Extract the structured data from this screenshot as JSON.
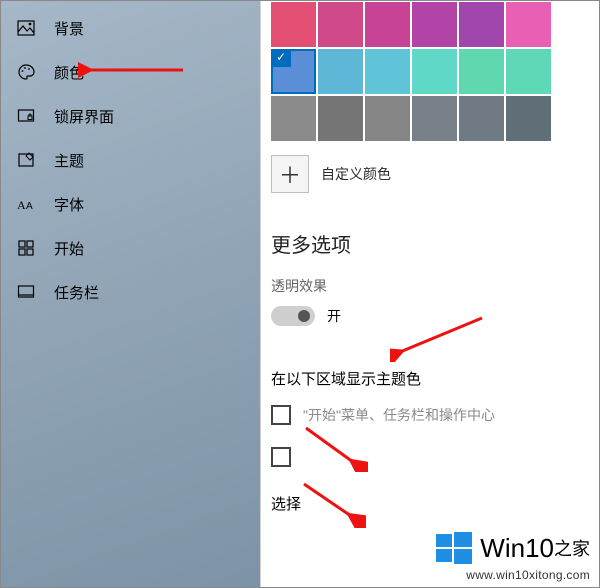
{
  "sidebar": {
    "items": [
      {
        "label": "背景",
        "name": "sidebar-item-background"
      },
      {
        "label": "颜色",
        "name": "sidebar-item-colors"
      },
      {
        "label": "锁屏界面",
        "name": "sidebar-item-lockscreen"
      },
      {
        "label": "主题",
        "name": "sidebar-item-themes"
      },
      {
        "label": "字体",
        "name": "sidebar-item-fonts"
      },
      {
        "label": "开始",
        "name": "sidebar-item-start"
      },
      {
        "label": "任务栏",
        "name": "sidebar-item-taskbar"
      }
    ]
  },
  "colors": {
    "rows": [
      [
        "#e45074",
        "#d04a8a",
        "#c64395",
        "#b244a8",
        "#a046ac",
        "#e85fb4"
      ],
      [
        "#5a8fd8",
        "#5fb7d8",
        "#5fc4d8",
        "#5fd8c8",
        "#5fd8b0",
        "#5fd8b7"
      ],
      [
        "#8b8b8b",
        "#757575",
        "#858585",
        "#7a808a",
        "#6f7a85",
        "#617078"
      ]
    ],
    "selected": {
      "row": 1,
      "col": 0
    }
  },
  "customColor": {
    "addIcon": "＋",
    "label": "自定义颜色"
  },
  "moreOptions": {
    "title": "更多选项",
    "transparency": {
      "label": "透明效果",
      "state": "开"
    }
  },
  "showAccent": {
    "title": "在以下区域显示主题色",
    "option1": "\"开始\"菜单、任务栏和操作中心",
    "selectLabel": "选择"
  },
  "watermark": {
    "brand": "Win10",
    "suffix": "之家",
    "url": "www.win10xitong.com"
  }
}
